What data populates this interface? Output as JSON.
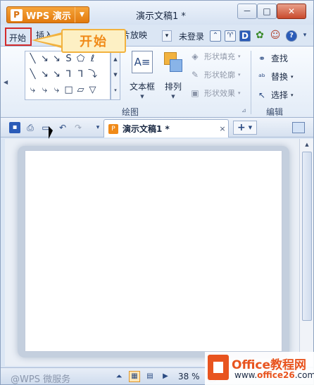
{
  "titlebar": {
    "app_name": "WPS 演示",
    "app_logo": "P",
    "document_title": "演示文稿1 *",
    "controls": [
      "－",
      "□",
      "✕"
    ]
  },
  "tabs": {
    "home": "开始",
    "insert": "插入",
    "slideshow": "片放映",
    "more": "▾",
    "login": "未登录"
  },
  "callout": {
    "label": "开始"
  },
  "ribbon": {
    "shapes": [
      "╲",
      "↘",
      "↘",
      "S",
      "⬠",
      "ℓ",
      "",
      "╲",
      "↘",
      "↘",
      "⅂",
      "⅂",
      "⤵",
      "",
      "⤷",
      "⤷",
      "⤷",
      "□",
      "▱",
      "▽",
      ""
    ],
    "textbox_icon": "A≡",
    "textbox_label": "文本框",
    "arrange_label": "排列",
    "shape_fill": "形状填充",
    "shape_outline": "形状轮廓",
    "shape_effect": "形状效果",
    "drawing_group": "绘图",
    "find": "查找",
    "replace": "替换",
    "select": "选择",
    "edit_group": "编辑"
  },
  "doc_tab": {
    "label": "演示文稿1 *",
    "close": "×",
    "new": "+"
  },
  "status": {
    "watermark": "@WPS 微服务",
    "zoom": "38 %"
  },
  "brand": {
    "name": "Office教程网",
    "url_prefix": "www.",
    "url_highlight": "office26",
    "url_suffix": ".com"
  },
  "colors": {
    "accent": "#e27a0e",
    "highlight_border": "#d42b2b",
    "callout_text": "#f08a18",
    "brand": "#e8541f"
  }
}
